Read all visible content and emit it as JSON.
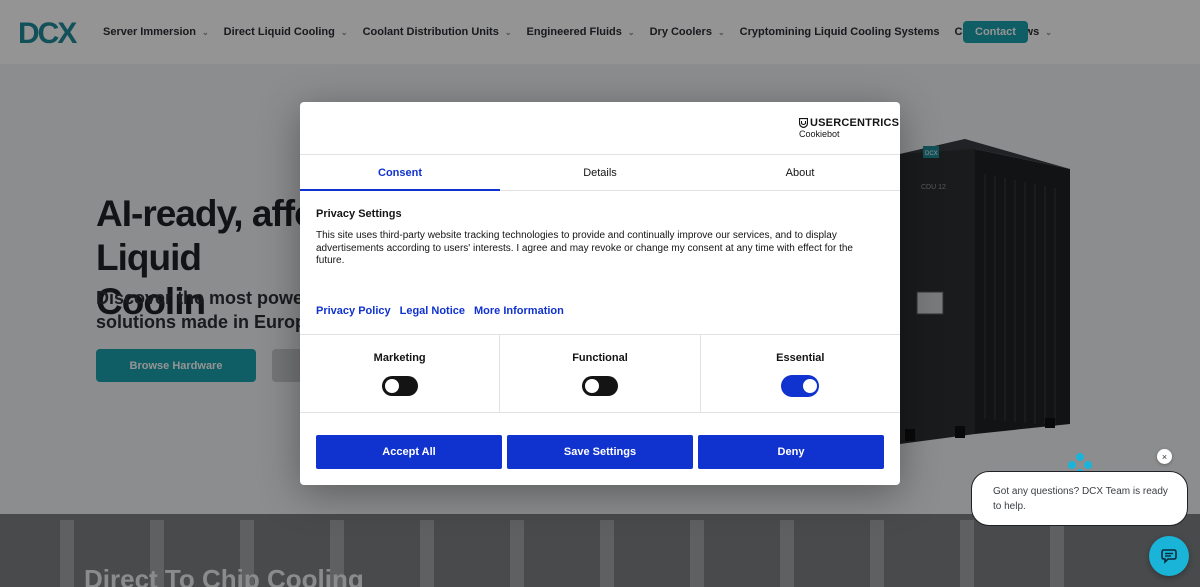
{
  "header": {
    "logo_text": "DCX",
    "nav": [
      {
        "label": "Server Immersion",
        "has_dropdown": true
      },
      {
        "label": "Direct Liquid Cooling",
        "has_dropdown": true
      },
      {
        "label": "Coolant Distribution Units",
        "has_dropdown": true
      },
      {
        "label": "Engineered Fluids",
        "has_dropdown": true
      },
      {
        "label": "Dry Coolers",
        "has_dropdown": true
      },
      {
        "label": "Cryptomining Liquid Cooling Systems",
        "has_dropdown": false
      },
      {
        "label": "Careers",
        "has_dropdown": false
      },
      {
        "label": "News",
        "has_dropdown": true
      }
    ],
    "contact_label": "Contact"
  },
  "hero": {
    "title": "AI-ready, affo\nLiquid Coolin",
    "subtitle": "Discover the most powe\nsolutions made in Europ",
    "browse_label": "Browse Hardware",
    "product_badge": "DCX",
    "product_model": "CDU 12"
  },
  "lower": {
    "title": "Direct To Chip Cooling"
  },
  "dialog": {
    "brand": "USERCENTRICS",
    "brand_sub": "Cookiebot",
    "tabs": [
      "Consent",
      "Details",
      "About"
    ],
    "active_tab": "Consent",
    "body_title": "Privacy Settings",
    "body_text": "This site uses third-party website tracking technologies to provide and continually improve our services, and to display advertisements according to users' interests. I agree and may revoke or change my consent at any time with effect for the future.",
    "links": [
      "Privacy Policy",
      "Legal Notice",
      "More Information"
    ],
    "toggles": [
      {
        "label": "Marketing",
        "on": false
      },
      {
        "label": "Functional",
        "on": false
      },
      {
        "label": "Essential",
        "on": true
      }
    ],
    "buttons": {
      "accept": "Accept All",
      "save": "Save Settings",
      "deny": "Deny"
    }
  },
  "chat": {
    "message": "Got any questions? DCX Team is ready to help.",
    "close_glyph": "×"
  },
  "colors": {
    "brand_teal": "#1aa0ae",
    "consent_blue": "#1032cf",
    "chat_blue": "#1ab4d8"
  }
}
